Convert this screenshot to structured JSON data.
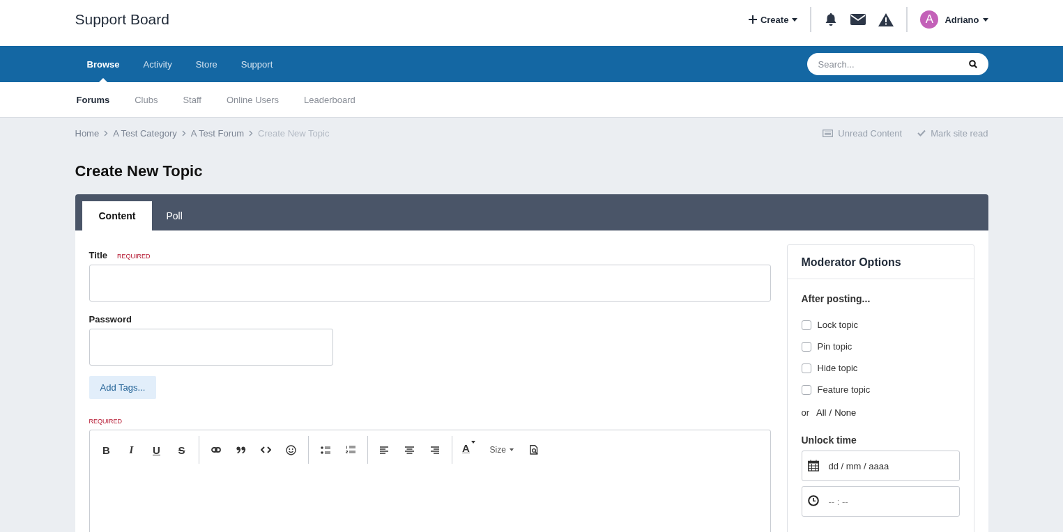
{
  "header": {
    "site_title": "Support Board",
    "create": "Create",
    "user": {
      "initial": "A",
      "name": "Adriano"
    }
  },
  "nav": {
    "items": [
      {
        "label": "Browse",
        "selected": true
      },
      {
        "label": "Activity",
        "selected": false
      },
      {
        "label": "Store",
        "selected": false
      },
      {
        "label": "Support",
        "selected": false
      }
    ],
    "search": {
      "placeholder": "Search..."
    }
  },
  "subnav": [
    {
      "label": "Forums",
      "selected": true
    },
    {
      "label": "Clubs",
      "selected": false
    },
    {
      "label": "Staff",
      "selected": false
    },
    {
      "label": "Online Users",
      "selected": false
    },
    {
      "label": "Leaderboard",
      "selected": false
    }
  ],
  "breadcrumb": [
    {
      "label": "Home",
      "current": false
    },
    {
      "label": "A Test Category",
      "current": false
    },
    {
      "label": "A Test Forum",
      "current": false
    },
    {
      "label": "Create New Topic",
      "current": true
    }
  ],
  "page_actions": [
    {
      "kind": "unread",
      "label": "Unread Content"
    },
    {
      "kind": "mark",
      "label": "Mark site read"
    }
  ],
  "page_title": "Create New Topic",
  "tabs": [
    {
      "label": "Content",
      "selected": true
    },
    {
      "label": "Poll",
      "selected": false
    }
  ],
  "form": {
    "title": {
      "label": "Title",
      "required": "REQUIRED"
    },
    "password": {
      "label": "Password"
    },
    "add_tags": "Add Tags...",
    "editor": {
      "required": "REQUIRED",
      "toolbar": [
        [
          {
            "kind": "bold",
            "text": "B"
          },
          {
            "kind": "italic",
            "text": "I"
          },
          {
            "kind": "underline",
            "text": "U"
          },
          {
            "kind": "strike",
            "text": "S"
          }
        ],
        [
          {
            "kind": "link"
          },
          {
            "kind": "quote"
          },
          {
            "kind": "code"
          },
          {
            "kind": "emoji"
          }
        ],
        [
          {
            "kind": "bullets"
          },
          {
            "kind": "numbers"
          }
        ],
        [
          {
            "kind": "align-left"
          },
          {
            "kind": "align-center"
          },
          {
            "kind": "align-right"
          }
        ],
        [
          {
            "kind": "color",
            "text": "A"
          },
          {
            "kind": "size",
            "text": "Size"
          },
          {
            "kind": "preview"
          }
        ]
      ]
    }
  },
  "moderator": {
    "title": "Moderator Options",
    "after_posting": "After posting...",
    "options": [
      {
        "label": "Lock topic",
        "checked": false
      },
      {
        "label": "Pin topic",
        "checked": false
      },
      {
        "label": "Hide topic",
        "checked": false
      },
      {
        "label": "Feature topic",
        "checked": false
      }
    ],
    "or": "or",
    "all": "All",
    "separator": "/",
    "none": "None",
    "unlock_time": "Unlock time",
    "date_placeholder": "dd / mm / aaaa",
    "time_placeholder": "-- : --"
  }
}
